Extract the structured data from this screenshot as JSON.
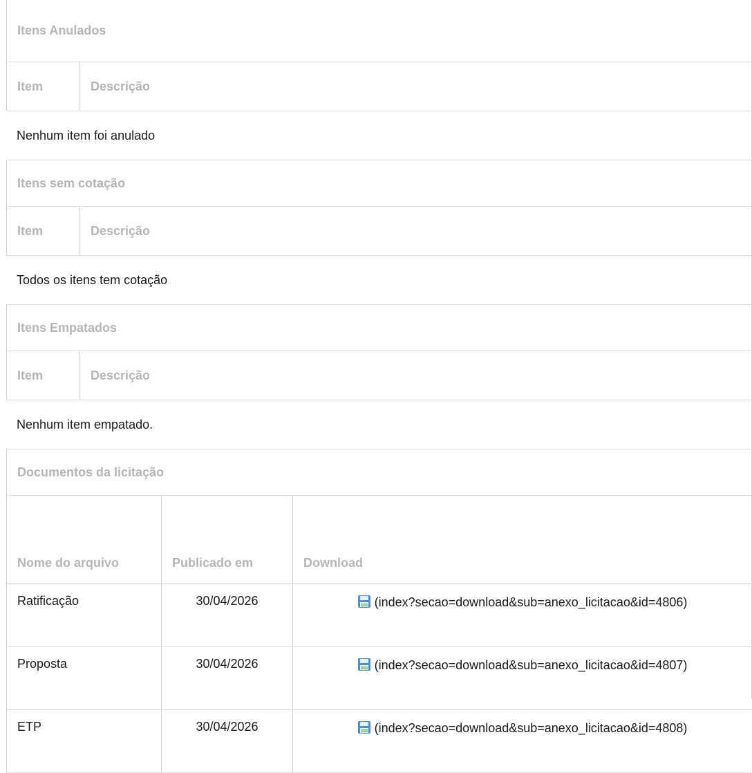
{
  "annulled": {
    "title": "Itens Anulados",
    "col_item": "Item",
    "col_desc": "Descrição",
    "message": "Nenhum item foi anulado"
  },
  "no_quote": {
    "title": "Itens sem cotação",
    "col_item": "Item",
    "col_desc": "Descrição",
    "message": "Todos os itens tem cotação"
  },
  "tied": {
    "title": "Itens Empatados",
    "col_item": "Item",
    "col_desc": "Descrição",
    "message": "Nenhum item empatado."
  },
  "documents": {
    "title": "Documentos da licitação",
    "col_name": "Nome do arquivo",
    "col_published": "Publicado em",
    "col_download": "Download",
    "rows": [
      {
        "name": "Ratificação",
        "date": "30/04/2026",
        "link": "(index?secao=download&sub=anexo_licitacao&id=4806)"
      },
      {
        "name": "Proposta",
        "date": "30/04/2026",
        "link": "(index?secao=download&sub=anexo_licitacao&id=4807)"
      },
      {
        "name": "ETP",
        "date": "30/04/2026",
        "link": "(index?secao=download&sub=anexo_licitacao&id=4808)"
      }
    ],
    "icon": "save-disk-icon"
  }
}
